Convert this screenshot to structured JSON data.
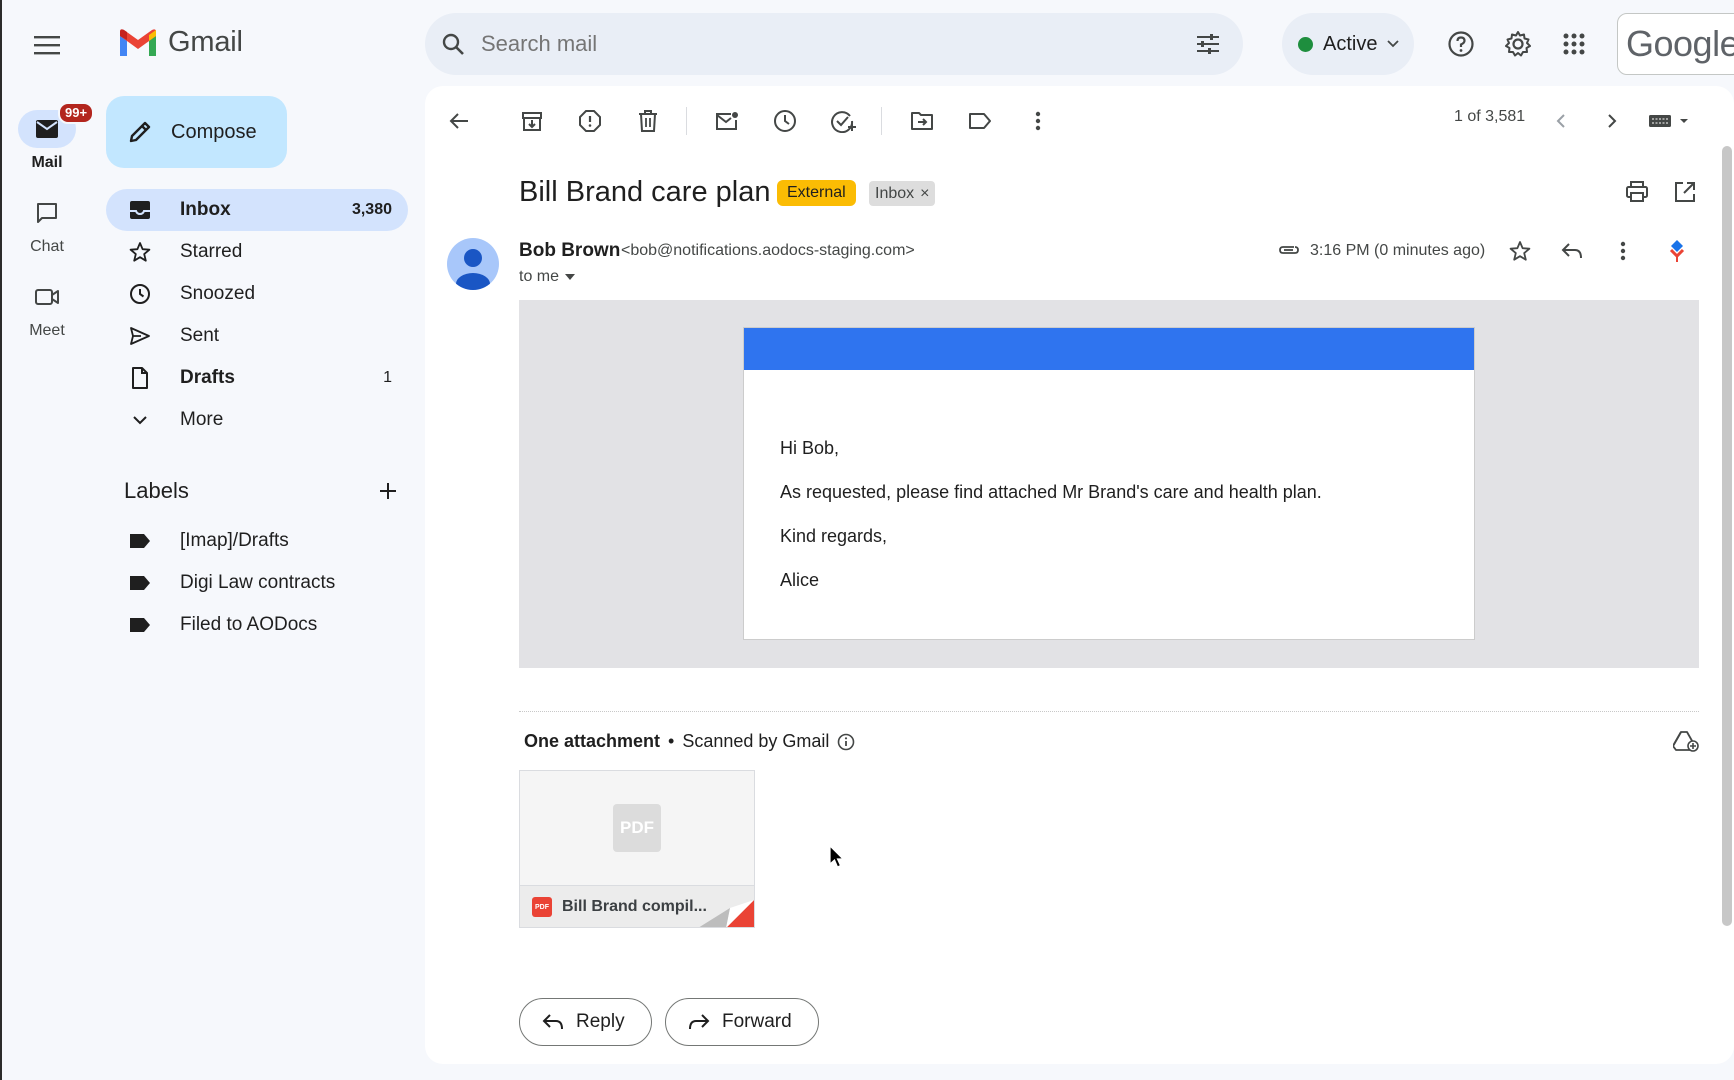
{
  "rail": {
    "items": [
      {
        "label": "Mail",
        "badge": "99+"
      },
      {
        "label": "Chat"
      },
      {
        "label": "Meet"
      }
    ]
  },
  "header": {
    "app_name": "Gmail",
    "search_placeholder": "Search mail",
    "status": "Active",
    "google_label": "Google"
  },
  "sidebar": {
    "compose_label": "Compose",
    "items": [
      {
        "label": "Inbox",
        "count": "3,380"
      },
      {
        "label": "Starred",
        "count": ""
      },
      {
        "label": "Snoozed",
        "count": ""
      },
      {
        "label": "Sent",
        "count": ""
      },
      {
        "label": "Drafts",
        "count": "1"
      },
      {
        "label": "More",
        "count": ""
      }
    ],
    "labels_title": "Labels",
    "labels": [
      "[Imap]/Drafts",
      "Digi Law contracts",
      "Filed to AODocs"
    ]
  },
  "toolbar": {
    "pager": "1 of 3,581"
  },
  "email": {
    "subject": "Bill Brand care plan",
    "chips": {
      "external": "External",
      "inbox": "Inbox",
      "inbox_remove": "×"
    },
    "sender_name": "Bob Brown",
    "sender_email": "<bob@notifications.aodocs-staging.com>",
    "to": "to me",
    "timestamp": "3:16 PM (0 minutes ago)",
    "body": {
      "greeting": "Hi Bob,",
      "line1": "As requested, please find attached Mr Brand's care and health plan.",
      "closing": "Kind regards,",
      "signature": "Alice"
    },
    "attachments": {
      "heading": "One attachment",
      "separator": "•",
      "scanned": "Scanned by Gmail",
      "file_name": "Bill Brand compil...",
      "thumb_label": "PDF",
      "mini_label": "PDF"
    },
    "actions": {
      "reply": "Reply",
      "forward": "Forward"
    }
  },
  "colors": {
    "accent": "#0b57d0",
    "compose_bg": "#c2e7ff",
    "active_nav": "#d3e3fd",
    "external_chip": "#fbbc04",
    "email_banner": "#2f74ef",
    "badge": "#b3261e",
    "status_dot": "#1e8e3e"
  }
}
